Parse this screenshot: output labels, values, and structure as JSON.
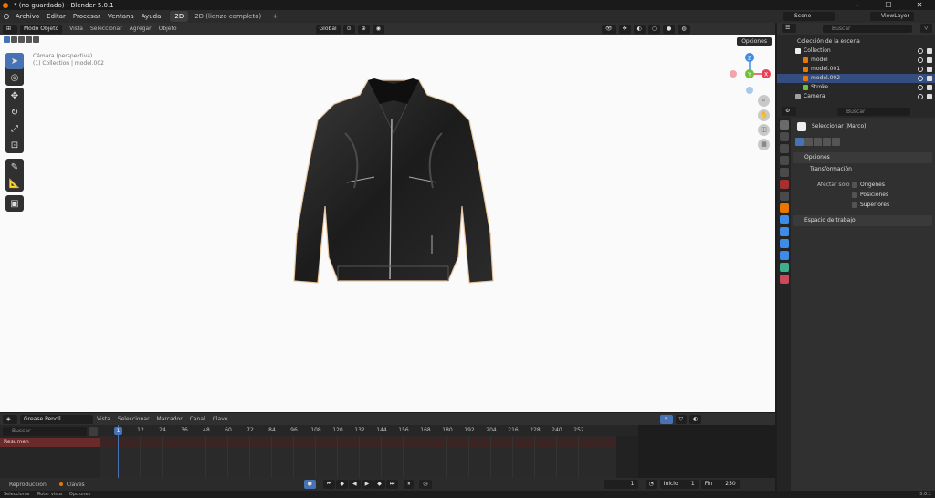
{
  "window": {
    "title": "* (no guardado) - Blender 5.0.1",
    "minimize": "–",
    "maximize": "☐",
    "close": "✕"
  },
  "menubar": {
    "items": [
      "Archivo",
      "Editar",
      "Procesar",
      "Ventana",
      "Ayuda"
    ],
    "tabs": [
      "2D",
      "2D (lienzo completo)"
    ],
    "add_tab": "+",
    "scene": "Scene",
    "view_layer": "ViewLayer"
  },
  "viewport": {
    "mode": "Modo Objeto",
    "menus": [
      "Vista",
      "Seleccionar",
      "Agregar",
      "Objeto"
    ],
    "orientation": "Global",
    "camera_label": "Cámara (perspectiva)",
    "collection_label": "(1) Collection | model.002",
    "options": "Opciones",
    "gizmo": {
      "x": "X",
      "y": "Y",
      "z": "Z"
    }
  },
  "timeline": {
    "editor": "Grease Pencil",
    "menus": [
      "Vista",
      "Seleccionar",
      "Marcador",
      "Canal",
      "Clave"
    ],
    "search_placeholder": "Buscar",
    "channel": "Resumen",
    "ticks": [
      "12",
      "24",
      "36",
      "48",
      "60",
      "72",
      "84",
      "96",
      "108",
      "120",
      "132",
      "144",
      "156",
      "168",
      "180",
      "192",
      "204",
      "216",
      "228",
      "240",
      "252"
    ],
    "current_frame": "1",
    "playback": "Reproducción",
    "keys": "Claves",
    "frame_field": "1",
    "start_label": "Inicio",
    "start": "1",
    "end_label": "Fin",
    "end": "250"
  },
  "statusbar": {
    "items": [
      "Seleccionar",
      "Rotar vista",
      "Opciones"
    ],
    "version": "5.0.1"
  },
  "outliner": {
    "search_placeholder": "Buscar",
    "root": "Colección de la escena",
    "rows": [
      {
        "label": "Collection",
        "icon": "collection-icon"
      },
      {
        "label": "model",
        "icon": "mesh-icon"
      },
      {
        "label": "model.001",
        "icon": "mesh-icon"
      },
      {
        "label": "model.002",
        "icon": "mesh-icon"
      },
      {
        "label": "Stroke",
        "icon": "grease-pencil-icon"
      },
      {
        "label": "Camera",
        "icon": "camera-icon"
      }
    ]
  },
  "properties": {
    "search_placeholder": "Buscar",
    "tool_name": "Seleccionar (Marco)",
    "panel_options": "Opciones",
    "subpanel_transform": "Transformación",
    "affect_only_label": "Afectar sólo",
    "checks": [
      "Orígenes",
      "Posiciones",
      "Superiores"
    ],
    "workspace_panel": "Espacio de trabajo"
  },
  "colors": {
    "accent": "#4772b3",
    "selected_row": "#334d80",
    "object_orange": "#ea7600",
    "gizmo_x": "#e9405a",
    "gizmo_y": "#6ec238",
    "gizmo_z": "#3f8ce6"
  }
}
